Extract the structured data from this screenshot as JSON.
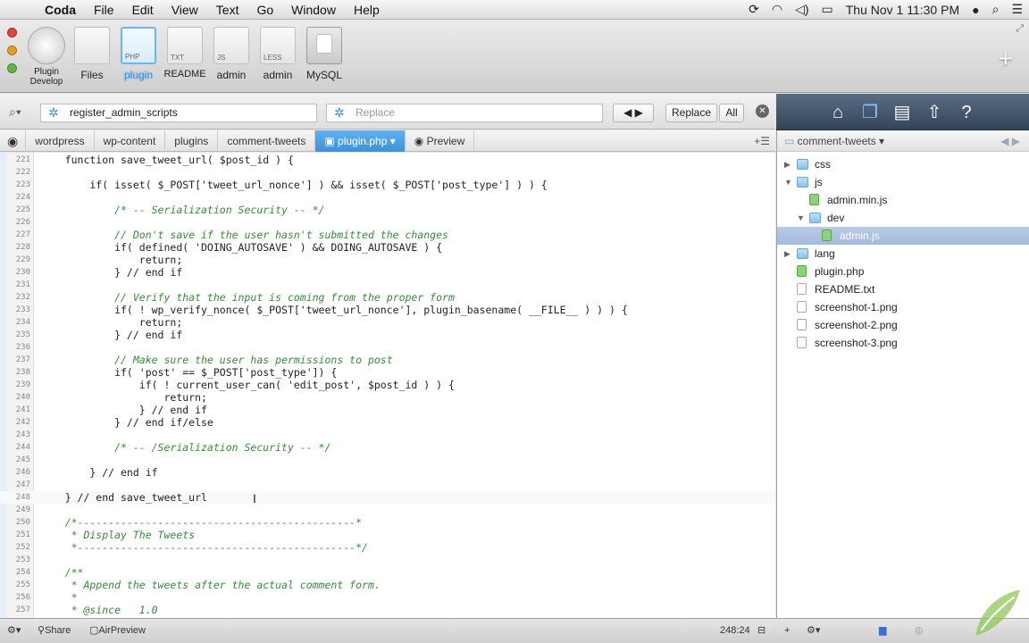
{
  "menubar": {
    "app": "Coda",
    "items": [
      "File",
      "Edit",
      "View",
      "Text",
      "Go",
      "Window",
      "Help"
    ],
    "clock": "Thu Nov 1  11:30 PM"
  },
  "sites": [
    {
      "label": "Plugin\nDevelop",
      "tag": ""
    },
    {
      "label": "Files",
      "tag": ""
    },
    {
      "label": "plugin",
      "tag": "PHP"
    },
    {
      "label": "README",
      "tag": "TXT"
    },
    {
      "label": "admin",
      "tag": "JS"
    },
    {
      "label": "admin",
      "tag": "LESS"
    },
    {
      "label": "MySQL",
      "tag": ""
    }
  ],
  "find": {
    "value": "register_admin_scripts",
    "replace_placeholder": "Replace",
    "replace_btn": "Replace",
    "all_btn": "All"
  },
  "crumbs": [
    "wordpress",
    "wp-content",
    "plugins",
    "comment-tweets",
    "plugin.php",
    "Preview"
  ],
  "code": [
    {
      "n": "221",
      "t": "    function save_tweet_url( $post_id ) {"
    },
    {
      "n": "222",
      "t": ""
    },
    {
      "n": "223",
      "t": "        if( isset( $_POST['tweet_url_nonce'] ) && isset( $_POST['post_type'] ) ) {"
    },
    {
      "n": "224",
      "t": ""
    },
    {
      "n": "225",
      "t": "            /* -- Serialization Security -- */"
    },
    {
      "n": "226",
      "t": ""
    },
    {
      "n": "227",
      "t": "            // Don't save if the user hasn't submitted the changes"
    },
    {
      "n": "228",
      "t": "            if( defined( 'DOING_AUTOSAVE' ) && DOING_AUTOSAVE ) {"
    },
    {
      "n": "229",
      "t": "                return;"
    },
    {
      "n": "230",
      "t": "            } // end if"
    },
    {
      "n": "231",
      "t": ""
    },
    {
      "n": "232",
      "t": "            // Verify that the input is coming from the proper form"
    },
    {
      "n": "233",
      "t": "            if( ! wp_verify_nonce( $_POST['tweet_url_nonce'], plugin_basename( __FILE__ ) ) ) {"
    },
    {
      "n": "234",
      "t": "                return;"
    },
    {
      "n": "235",
      "t": "            } // end if"
    },
    {
      "n": "236",
      "t": ""
    },
    {
      "n": "237",
      "t": "            // Make sure the user has permissions to post"
    },
    {
      "n": "238",
      "t": "            if( 'post' == $_POST['post_type']) {"
    },
    {
      "n": "239",
      "t": "                if( ! current_user_can( 'edit_post', $post_id ) ) {"
    },
    {
      "n": "240",
      "t": "                    return;"
    },
    {
      "n": "241",
      "t": "                } // end if"
    },
    {
      "n": "242",
      "t": "            } // end if/else"
    },
    {
      "n": "243",
      "t": ""
    },
    {
      "n": "244",
      "t": "            /* -- /Serialization Security -- */"
    },
    {
      "n": "245",
      "t": ""
    },
    {
      "n": "246",
      "t": "        } // end if"
    },
    {
      "n": "247",
      "t": ""
    },
    {
      "n": "248",
      "t": "    } // end save_tweet_url"
    },
    {
      "n": "249",
      "t": ""
    },
    {
      "n": "250",
      "t": "    /*---------------------------------------------*"
    },
    {
      "n": "251",
      "t": "     * Display The Tweets"
    },
    {
      "n": "252",
      "t": "     *---------------------------------------------*/"
    },
    {
      "n": "253",
      "t": ""
    },
    {
      "n": "254",
      "t": "    /**"
    },
    {
      "n": "255",
      "t": "     * Append the tweets after the actual comment form."
    },
    {
      "n": "256",
      "t": "     *"
    },
    {
      "n": "257",
      "t": "     * @since   1.0"
    }
  ],
  "sidebar": {
    "root": "comment-tweets",
    "files": [
      {
        "name": "css",
        "type": "folder",
        "depth": 0,
        "tri": "▶",
        "sel": false
      },
      {
        "name": "js",
        "type": "folder",
        "depth": 0,
        "tri": "▼",
        "sel": false
      },
      {
        "name": "admin.min.js",
        "type": "green",
        "depth": 1,
        "tri": "",
        "sel": false
      },
      {
        "name": "dev",
        "type": "folder",
        "depth": 1,
        "tri": "▼",
        "sel": false
      },
      {
        "name": "admin.js",
        "type": "green",
        "depth": 2,
        "tri": "",
        "sel": true
      },
      {
        "name": "lang",
        "type": "folder",
        "depth": 0,
        "tri": "▶",
        "sel": false
      },
      {
        "name": "plugin.php",
        "type": "green",
        "depth": 0,
        "tri": "",
        "sel": false
      },
      {
        "name": "README.txt",
        "type": "file",
        "depth": 0,
        "tri": "",
        "sel": false
      },
      {
        "name": "screenshot-1.png",
        "type": "file",
        "depth": 0,
        "tri": "",
        "sel": false
      },
      {
        "name": "screenshot-2.png",
        "type": "file",
        "depth": 0,
        "tri": "",
        "sel": false
      },
      {
        "name": "screenshot-3.png",
        "type": "file",
        "depth": 0,
        "tri": "",
        "sel": false
      }
    ]
  },
  "status": {
    "share": "Share",
    "airpreview": "AirPreview",
    "position": "248:24"
  },
  "colors": {
    "accent": "#3f91d8",
    "comment": "#3a8a3a",
    "selection": "#a3bada"
  }
}
